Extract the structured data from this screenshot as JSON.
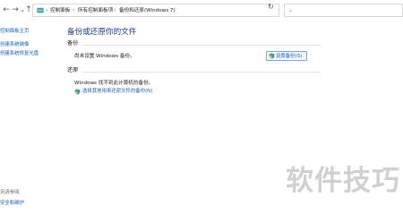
{
  "nav": {
    "back_icon": "←",
    "forward_icon": "→",
    "dropdown_icon": "⌄",
    "up_icon": "↑"
  },
  "address_bar": {
    "icon": "control-panel-icon",
    "crumbs": [
      "控制面板",
      "所有控制面板项",
      "备份和还原(Windows 7)"
    ],
    "separator": "›",
    "dropdown_icon": "⌄",
    "refresh_icon": "↻"
  },
  "sidebar": {
    "items": [
      "控制面板主页",
      "创建系统映像",
      "创建系统修复光盘"
    ],
    "see_also": "另请参阅",
    "bottom_item": "安全和维护"
  },
  "main": {
    "title": "备份或还原你的文件",
    "backup": {
      "heading": "备份",
      "status": "尚未设置 Windows 备份。",
      "setup_button": "设置备份(S)"
    },
    "restore": {
      "heading": "还原",
      "status": "Windows 找不到此计算机的备份。",
      "link": "选择其他用来还原文件的备份(N)"
    }
  },
  "watermark": "软件技巧",
  "colors": {
    "link": "#1a5fb4",
    "title": "#1e3c8c",
    "accent": "#7aa7d8"
  }
}
